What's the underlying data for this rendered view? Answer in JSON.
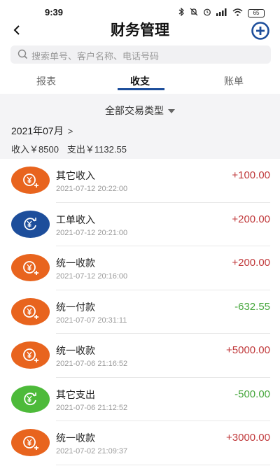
{
  "status": {
    "time": "9:39",
    "battery": "65"
  },
  "header": {
    "title": "财务管理"
  },
  "search": {
    "placeholder": "搜索单号、客户名称、电话号码"
  },
  "tabs": [
    {
      "label": "报表",
      "active": false
    },
    {
      "label": "收支",
      "active": true
    },
    {
      "label": "账单",
      "active": false
    }
  ],
  "filter": {
    "label": "全部交易类型"
  },
  "period": {
    "month": "2021年07月",
    "income": "收入￥8500",
    "expense": "支出￥1132.55"
  },
  "transactions": [
    {
      "title": "其它收入",
      "time": "2021-07-12 20:22:00",
      "amount": "+100.00",
      "type": "income",
      "icon_color": "#e8641e",
      "icon": "yen-plus-icon"
    },
    {
      "title": "工单收入",
      "time": "2021-07-12 20:21:00",
      "amount": "+200.00",
      "type": "income",
      "icon_color": "#1d4e9b",
      "icon": "yen-refresh-icon"
    },
    {
      "title": "统一收款",
      "time": "2021-07-12 20:16:00",
      "amount": "+200.00",
      "type": "income",
      "icon_color": "#e8641e",
      "icon": "yen-plus-icon"
    },
    {
      "title": "统一付款",
      "time": "2021-07-07 20:31:11",
      "amount": "-632.55",
      "type": "expense",
      "icon_color": "#e8641e",
      "icon": "yen-plus-icon"
    },
    {
      "title": "统一收款",
      "time": "2021-07-06 21:16:52",
      "amount": "+5000.00",
      "type": "income",
      "icon_color": "#e8641e",
      "icon": "yen-plus-icon"
    },
    {
      "title": "其它支出",
      "time": "2021-07-06 21:12:52",
      "amount": "-500.00",
      "type": "expense",
      "icon_color": "#4dba3a",
      "icon": "yen-refresh-icon"
    },
    {
      "title": "统一收款",
      "time": "2021-07-02 21:09:37",
      "amount": "+3000.00",
      "type": "income",
      "icon_color": "#e8641e",
      "icon": "yen-plus-icon"
    }
  ],
  "colors": {
    "accent": "#1d4e9b",
    "income_text": "#c0393b",
    "expense_text": "#45a63b"
  }
}
